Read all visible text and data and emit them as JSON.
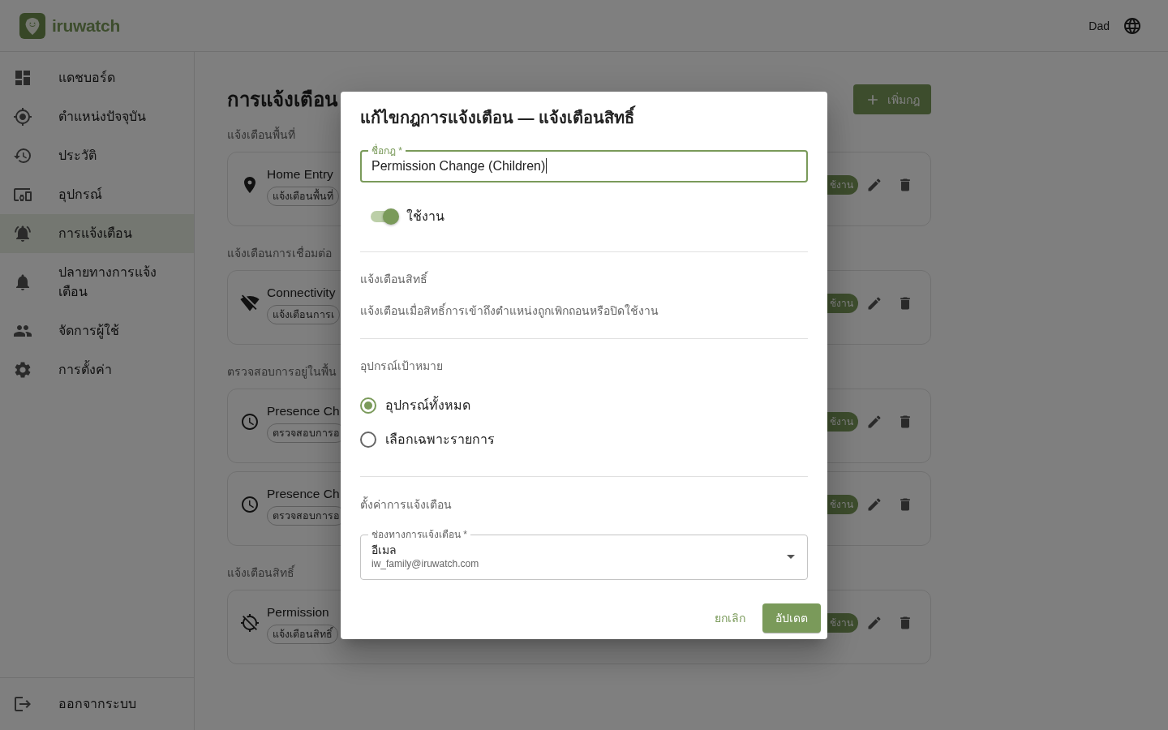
{
  "header": {
    "brand": "iruwatch",
    "user_name": "Dad"
  },
  "sidebar": {
    "items": [
      {
        "kind": "dashboard",
        "label": "แดชบอร์ด",
        "selected": false
      },
      {
        "kind": "location",
        "label": "ตำแหน่งปัจจุบัน",
        "selected": false
      },
      {
        "kind": "history",
        "label": "ประวัติ",
        "selected": false
      },
      {
        "kind": "devices",
        "label": "อุปกรณ์",
        "selected": false
      },
      {
        "kind": "alerts",
        "label": "การแจ้งเตือน",
        "selected": true
      },
      {
        "kind": "destinations",
        "label": "ปลายทางการแจ้งเตือน",
        "selected": false
      },
      {
        "kind": "users",
        "label": "จัดการผู้ใช้",
        "selected": false
      },
      {
        "kind": "settings",
        "label": "การตั้งค่า",
        "selected": false
      }
    ],
    "logout": "ออกจากระบบ"
  },
  "page": {
    "title": "การแจ้งเตือน",
    "add_button": "เพิ่มกฎ",
    "sections": [
      {
        "heading": "แจ้งเตือนพื้นที่",
        "rules": [
          {
            "kind": "area",
            "name": "Home Entry",
            "type": "แจ้งเตือนพื้นที่",
            "status": "ช้งาน"
          }
        ]
      },
      {
        "heading": "แจ้งเตือนการเชื่อมต่อ",
        "rules": [
          {
            "kind": "connectivity",
            "name": "Connectivity",
            "type": "แจ้งเตือนการเ",
            "status": "ช้งาน"
          }
        ]
      },
      {
        "heading": "ตรวจสอบการอยู่ในพื้น",
        "rules": [
          {
            "kind": "presence",
            "name": "Presence Ch",
            "type": "ตรวจสอบการอ",
            "status": "ช้งาน"
          },
          {
            "kind": "presence",
            "name": "Presence Ch",
            "type": "ตรวจสอบการอ",
            "status": "ช้งาน"
          }
        ]
      },
      {
        "heading": "แจ้งเตือนสิทธิ์",
        "rules": [
          {
            "kind": "permission",
            "name": "Permission",
            "type": "แจ้งเตือนสิทธิ์",
            "status": "ช้งาน"
          }
        ]
      }
    ]
  },
  "dialog": {
    "title": "แก้ไขกฎการแจ้งเตือน — แจ้งเตือนสิทธิ์",
    "name_field": {
      "label": "ชื่อกฎ *",
      "value": "Permission Change (Children)",
      "focused": true
    },
    "enabled": {
      "label": "ใช้งาน",
      "on": true
    },
    "rule_type": {
      "heading": "แจ้งเตือนสิทธิ์",
      "description": "แจ้งเตือนเมื่อสิทธิ์การเข้าถึงตำแหน่งถูกเพิกถอนหรือปิดใช้งาน"
    },
    "target": {
      "heading": "อุปกรณ์เป้าหมาย",
      "options": [
        {
          "label": "อุปกรณ์ทั้งหมด",
          "selected": true
        },
        {
          "label": "เลือกเฉพาะรายการ",
          "selected": false
        }
      ]
    },
    "notification": {
      "heading": "ตั้งค่าการแจ้งเตือน",
      "channel": {
        "label": "ช่องทางการแจ้งเตือน *",
        "value": "อีเมล",
        "detail": "iw_family@iruwatch.com"
      }
    },
    "buttons": [
      {
        "kind": "text",
        "label": "ยกเลิก"
      },
      {
        "kind": "contained",
        "label": "อัปเดต"
      }
    ]
  }
}
